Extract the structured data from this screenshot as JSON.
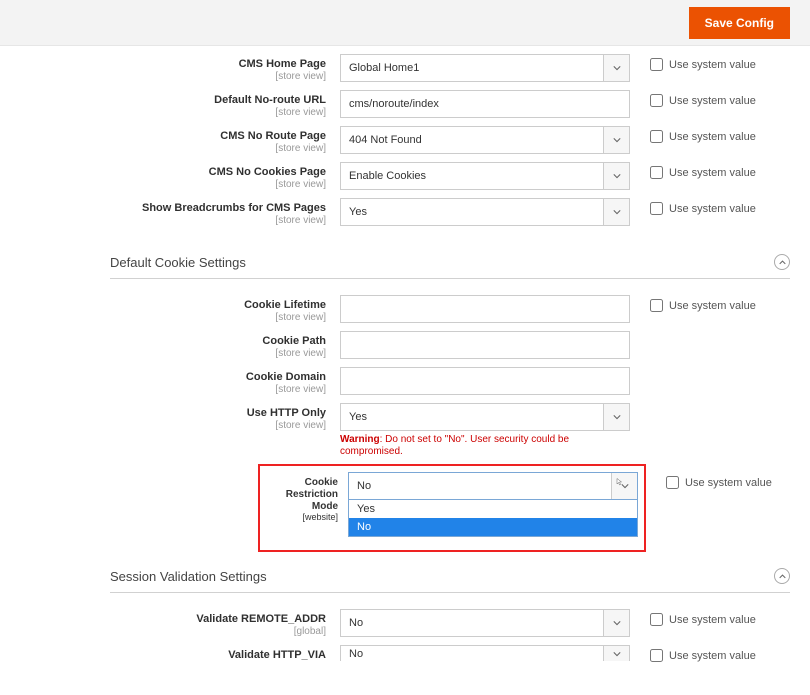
{
  "topbar": {
    "save_label": "Save Config"
  },
  "sections": {
    "general": {
      "cms_home_page": {
        "label": "CMS Home Page",
        "scope": "[store view]",
        "value": "Global Home1",
        "sys": "Use system value"
      },
      "no_route_url": {
        "label": "Default No-route URL",
        "scope": "[store view]",
        "value": "cms/noroute/index",
        "sys": "Use system value"
      },
      "cms_no_route_page": {
        "label": "CMS No Route Page",
        "scope": "[store view]",
        "value": "404 Not Found",
        "sys": "Use system value"
      },
      "cms_no_cookies_page": {
        "label": "CMS No Cookies Page",
        "scope": "[store view]",
        "value": "Enable Cookies",
        "sys": "Use system value"
      },
      "show_breadcrumbs": {
        "label": "Show Breadcrumbs for CMS Pages",
        "scope": "[store view]",
        "value": "Yes",
        "sys": "Use system value"
      }
    },
    "cookie": {
      "title": "Default Cookie Settings",
      "cookie_lifetime": {
        "label": "Cookie Lifetime",
        "scope": "[store view]",
        "value": "",
        "sys": "Use system value"
      },
      "cookie_path": {
        "label": "Cookie Path",
        "scope": "[store view]",
        "value": ""
      },
      "cookie_domain": {
        "label": "Cookie Domain",
        "scope": "[store view]",
        "value": ""
      },
      "use_http_only": {
        "label": "Use HTTP Only",
        "scope": "[store view]",
        "value": "Yes",
        "warn_prefix": "Warning",
        "warn_text": ": Do not set to \"No\". User security could be compromised."
      },
      "cookie_restriction": {
        "label": "Cookie Restriction Mode",
        "scope": "[website]",
        "value": "No",
        "sys": "Use system value",
        "options": [
          "Yes",
          "No"
        ]
      }
    },
    "session": {
      "title": "Session Validation Settings",
      "validate_remote_addr": {
        "label": "Validate REMOTE_ADDR",
        "scope": "[global]",
        "value": "No",
        "sys": "Use system value"
      },
      "validate_http_via": {
        "label": "Validate HTTP_VIA",
        "value": "No",
        "sys": "Use system value"
      }
    }
  }
}
